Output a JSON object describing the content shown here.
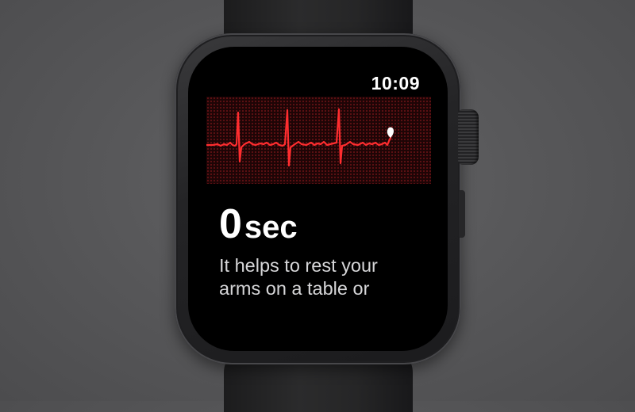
{
  "watch": {
    "status_bar": {
      "time": "10:09"
    },
    "ecg": {
      "line_color": "#ff2d2f",
      "grid_color": "#a81e23"
    },
    "recording": {
      "seconds_value": "0",
      "seconds_unit": "sec"
    },
    "instruction": {
      "line1": "It helps to rest your",
      "line2": "arms on a table or"
    }
  }
}
